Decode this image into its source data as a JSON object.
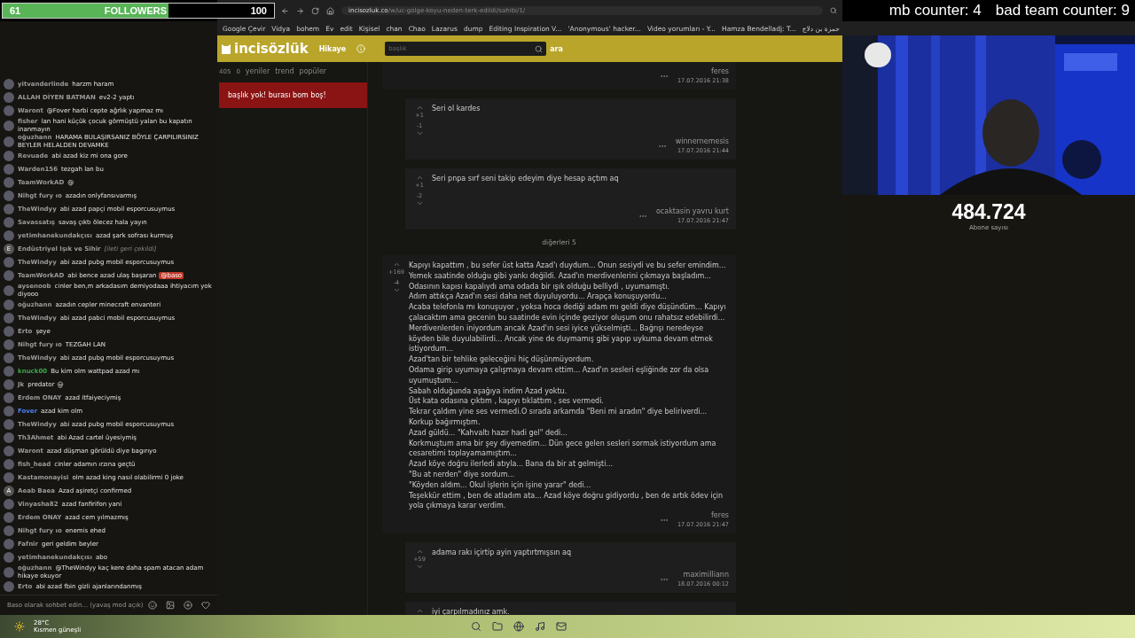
{
  "followers": {
    "current": "61",
    "label": "FOLLOWERS",
    "goal": "100",
    "level": 0.61
  },
  "counters": [
    "mb counter: 4",
    "bad team counter: 9"
  ],
  "browser": {
    "url_host": "incisozluk.co",
    "url_path": "/w/uc-golge-koyu-neden-terk-edildi/sahibi/1/",
    "bookmarks": [
      "Google Çevir",
      "Vidya",
      "bohem",
      "Ev",
      "edit",
      "Kişisel",
      "chan",
      "Chao",
      "Lazarus",
      "dump",
      "Editing Inspiration V...",
      "'Anonymous' hacker...",
      "Video yorumları - Y...",
      "Hamza Bendelladj: T...",
      "حمزة بن دلاج"
    ]
  },
  "chat": {
    "messages": [
      {
        "user": "yitvanderlinde",
        "text": "harzm haram",
        "kind": "text"
      },
      {
        "user": "ALLAH DİYEN BATMAN",
        "text": "ev2-2 yaptı",
        "kind": "text"
      },
      {
        "user": "Waront",
        "text": "@Fover harbi cepte ağrlık yapmaz mı",
        "kind": "text"
      },
      {
        "user": "fisher",
        "text": "lan hani küçük çocuk görmüştü yalan bu kapatın inanmayın",
        "kind": "text"
      },
      {
        "user": "oğuzhann",
        "text": "HARAMA BULAŞIRSANIZ BÖYLE ÇARPILIRSINIZ BEYLER HELALDEN DEVAMKE",
        "kind": "text"
      },
      {
        "user": "Revuade",
        "text": "abi azad kiz mi ona gore",
        "kind": "text"
      },
      {
        "user": "Warden156",
        "text": "tezgah lan bu",
        "kind": "text"
      },
      {
        "user": "TeamWorkAD",
        "text": "@",
        "kind": "text"
      },
      {
        "user": "Nihgt fury ıo",
        "text": "azadın onlyfansıvarmış",
        "kind": "text"
      },
      {
        "user": "TheWindyy",
        "text": "abi azad papçi mobil esporcusuymus",
        "kind": "text"
      },
      {
        "user": "Savassatış",
        "text": "savaş çıktı ölecez hala yayın",
        "kind": "text"
      },
      {
        "user": "yetimhanekundakçısı",
        "text": "azad şark sofrası kurmuş",
        "kind": "text"
      },
      {
        "user": "Endüstriyel Işık ve Sihir",
        "text": "[ileti geri çekildi]",
        "kind": "deleted",
        "initial": "E"
      },
      {
        "user": "TheWindyy",
        "text": "abi azad pubg mobil esporcusuymus",
        "kind": "text"
      },
      {
        "user": "TeamWorkAD",
        "text": "abi bence azad ulaş başaran",
        "mention": "@baso",
        "kind": "text"
      },
      {
        "user": "aysenoob",
        "text": "cinler ben,m arkadasım demiyodaaa ihtiyacım yok diyooo",
        "kind": "text"
      },
      {
        "user": "oğuzhann",
        "text": "azadın cepler minecraft envanteri",
        "kind": "text"
      },
      {
        "user": "TheWindyy",
        "text": "abi azad pabci mobil esporcusuymus",
        "kind": "text"
      },
      {
        "user": "Erto",
        "text": "şeye",
        "kind": "text"
      },
      {
        "user": "Nihgt fury ıo",
        "text": "TEZGAH LAN",
        "kind": "text"
      },
      {
        "user": "TheWindyy",
        "text": "abi azad pubg mobil esporcusuymus",
        "kind": "text"
      },
      {
        "user": "knuck00",
        "text": "Bu kim olm wattpad azad mı",
        "color": "#3aa84a",
        "kind": "text"
      },
      {
        "user": "Jk",
        "text": "predator",
        "kind": "skull"
      },
      {
        "user": "Erdem ONAY",
        "text": "azad itfaiyeciymiş",
        "kind": "text"
      },
      {
        "user": "Fover",
        "text": "azad kim olm",
        "color": "#4d7ff0",
        "kind": "text"
      },
      {
        "user": "TheWindyy",
        "text": "abi azad pubg mobil esporcusuymus",
        "kind": "text"
      },
      {
        "user": "Th3Ahmet",
        "text": "abi Azad cartel üyesiymiş",
        "kind": "text"
      },
      {
        "user": "Waront",
        "text": "azad düşman görüldü diye bagırıyo",
        "kind": "text"
      },
      {
        "user": "fish_head",
        "text": "cinler adamın ırzına geçtü",
        "kind": "text"
      },
      {
        "user": "Kastamonayisi",
        "text": "olm azad king nasıl olabilirmi 0 joke",
        "kind": "text"
      },
      {
        "user": "Aeab Baea",
        "text": "Azad aşiretçi confirmed",
        "kind": "text",
        "initial": "A"
      },
      {
        "user": "Vinyasha82",
        "text": "azad fanfirifon yani",
        "kind": "text"
      },
      {
        "user": "Erdem ONAY",
        "text": "azad cem yılmazmış",
        "kind": "text"
      },
      {
        "user": "Nihgt fury ıo",
        "text": "enemis ehed",
        "kind": "text"
      },
      {
        "user": "Fafnir",
        "text": "geri geldim beyler",
        "kind": "text"
      },
      {
        "user": "yetimhanekundakçısı",
        "text": "abo",
        "kind": "text"
      },
      {
        "user": "oğuzhann",
        "text": "@TheWindyy kaç kere daha spam atacan adam hikaye okuyor",
        "kind": "text"
      },
      {
        "user": "Erto",
        "text": "abi azad fbin gizli ajanlarındanmış",
        "kind": "text"
      }
    ],
    "input": {
      "placeholder": "Baso olarak sohbet edin... (yavaş mod açık)"
    }
  },
  "site": {
    "logo": "incisözlük",
    "nav": "Hikaye",
    "search": {
      "placeholder": "başlık"
    },
    "search_button": "ara",
    "stats": [
      "405",
      "0"
    ],
    "tabs": [
      {
        "label": "yeniler",
        "selected": false
      },
      {
        "label": "trend",
        "selected": false
      },
      {
        "label": "popüler",
        "selected": false
      }
    ],
    "notice": "başlık yok! burası bom boş!",
    "entries": [
      {
        "kind": "tail",
        "author": "feres",
        "date": "17.07.2016 21:38"
      },
      {
        "kind": "comment",
        "lines": [
          "Seri ol kardes"
        ],
        "up": "+1",
        "down": "-1",
        "author": "winnernemesis",
        "date": "17.07.2016 21:44"
      },
      {
        "kind": "comment",
        "lines": [
          "Seri pnpa sırf seni takip edeyim diye hesap açtım aq"
        ],
        "up": "+1",
        "down": "-2",
        "author": "ocaktasin yavru kurt",
        "date": "17.07.2016 21:47"
      },
      {
        "kind": "more",
        "label": "diğerleri 5"
      },
      {
        "kind": "entry",
        "lines": [
          "Kapıyı kapattım , bu sefer üst katta Azad'ı duydum... Onun sesiydi ve bu sefer emindim... Yemek saatinde olduğu gibi yankı değildi. Azad'ın merdivenlerini çıkmaya başladım... Odasının kapısı kapalıydı ama odada bir ışık olduğu belliydi , uyumamıştı.",
          "Adım attıkça Azad'ın sesi daha net duyuluyordu... Arapça konuşuyordu...",
          "Acaba telefonla mı konuşuyor , yoksa hoca dediği adam mı geldi diye düşündüm... Kapıyı çalacaktım ama gecenin bu saatinde evin içinde geziyor oluşum onu rahatsız edebilirdi...",
          "Merdivenlerden iniyordum ancak Azad'ın sesi iyice yükselmişti... Bağrışı neredeyse köyden bile duyulabilirdi... Ancak yine de duymamış gibi yapıp uykuma devam etmek istiyordum...",
          "Azad'tan bir tehlike geleceğini hiç düşünmüyordum.",
          "Odama girip uyumaya çalışmaya devam ettim... Azad'ın sesleri eşliğinde zor da olsa uyumuştum...",
          "Sabah olduğunda aşağıya indim Azad yoktu.",
          "Üst kata odasına çıktım , kapıyı tıklattım , ses vermedi.",
          "Tekrar çaldım yine ses vermedi.O sırada arkamda \"Beni mi aradın\" diye beliriverdi... Korkup bağırmıştım.",
          "Azad güldü... \"Kahvaltı hazır hadi gel\" dedi...",
          "Korkmuştum ama bir şey diyemedim... Dün gece gelen sesleri sormak istiyordum ama cesaretimi toplayamamıştım...",
          "Azad köye doğru ilerledi atıyla... Bana da bir at gelmişti...",
          "\"Bu at nerden\" diye sordum...",
          "\"Köyden aldım... Okul işlerin için işine yarar\" dedi...",
          "Teşekkür ettim , ben de atladım ata... Azad köye doğru gidiyordu , ben de artık ödev için yola çıkmaya karar verdim."
        ],
        "up": "+169",
        "down": "-4",
        "author": "feres",
        "date": "17.07.2016 21:47"
      },
      {
        "kind": "comment",
        "lines": [
          "adama rakı içirtip ayin yaptırtmışsın aq"
        ],
        "up": "+59",
        "author": "maximilliann",
        "date": "18.07.2016 00:12"
      },
      {
        "kind": "cut",
        "lines": [
          "iyi çarpılmadınız amk."
        ]
      }
    ]
  },
  "stream": {
    "subscribers": "484.724",
    "subscribers_label": "Abone sayısı"
  },
  "taskbar": {
    "temperature": "28°C",
    "weather": "Kısmen güneşli"
  }
}
